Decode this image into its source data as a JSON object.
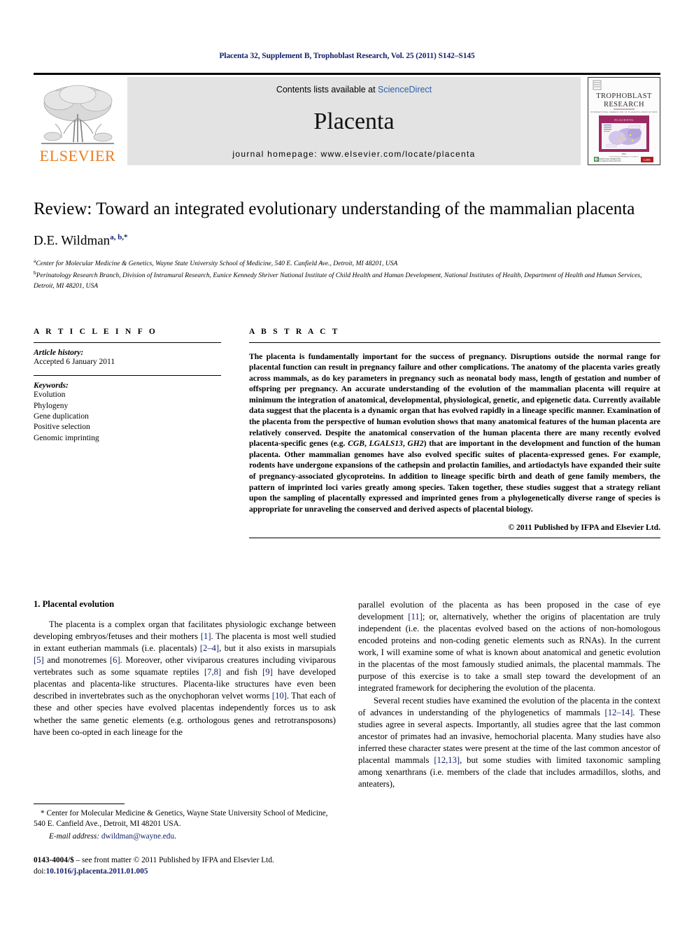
{
  "running_head": "Placenta 32, Supplement B, Trophoblast Research, Vol. 25 (2011) S142–S145",
  "masthead": {
    "publisher_name": "ELSEVIER",
    "contents_prefix": "Contents lists available at ",
    "contents_link": "ScienceDirect",
    "journal_name": "Placenta",
    "homepage": "journal homepage: www.elsevier.com/locate/placenta",
    "cover": {
      "line1": "TROPHOBLAST",
      "line2": "RESEARCH",
      "subtitle": "A JOURNAL OF THE INTERNATIONAL FEDERATION OF PLACENTA ASSOCIATIONS",
      "volume_label": "PLACENTA"
    }
  },
  "article": {
    "title": "Review: Toward an integrated evolutionary understanding of the mammalian placenta",
    "author": "D.E. Wildman",
    "author_marks": "a, b,*",
    "affiliation_a_mark": "a",
    "affiliation_a": "Center for Molecular Medicine & Genetics, Wayne State University School of Medicine, 540 E. Canfield Ave., Detroit, MI 48201, USA",
    "affiliation_b_mark": "b",
    "affiliation_b": "Perinatology Research Branch, Division of Intramural Research, Eunice Kennedy Shriver National Institute of Child Health and Human Development, National Institutes of Health, Department of Health and Human Services, Detroit, MI 48201, USA"
  },
  "article_info": {
    "heading": "A R T I C L E   I N F O",
    "history_label": "Article history:",
    "history_value": "Accepted 6 January 2011",
    "keywords_label": "Keywords:",
    "keywords": [
      "Evolution",
      "Phylogeny",
      "Gene duplication",
      "Positive selection",
      "Genomic imprinting"
    ]
  },
  "abstract": {
    "heading": "A B S T R A C T",
    "part1": "The placenta is fundamentally important for the success of pregnancy. Disruptions outside the normal range for placental function can result in pregnancy failure and other complications. The anatomy of the placenta varies greatly across mammals, as do key parameters in pregnancy such as neonatal body mass, length of gestation and number of offspring per pregnancy. An accurate understanding of the evolution of the mammalian placenta will require at minimum the integration of anatomical, developmental, physiological, genetic, and epigenetic data. Currently available data suggest that the placenta is a dynamic organ that has evolved rapidly in a lineage specific manner. Examination of the placenta from the perspective of human evolution shows that many anatomical features of the human placenta are relatively conserved. Despite the anatomical conservation of the human placenta there are many recently evolved placenta-specific genes (e.g. ",
    "gene1": "CGB",
    "sep1": ", ",
    "gene2": "LGALS13",
    "sep2": ", ",
    "gene3": "GH2",
    "part2": ") that are important in the development and function of the human placenta. Other mammalian genomes have also evolved specific suites of placenta-expressed genes. For example, rodents have undergone expansions of the cathepsin and prolactin families, and artiodactyls have expanded their suite of pregnancy-associated glycoproteins. In addition to lineage specific birth and death of gene family members, the pattern of imprinted loci varies greatly among species. Taken together, these studies suggest that a strategy reliant upon the sampling of placentally expressed and imprinted genes from a phylogenetically diverse range of species is appropriate for unraveling the conserved and derived aspects of placental biology.",
    "copyright": "© 2011 Published by IFPA and Elsevier Ltd."
  },
  "body": {
    "section_heading": "1. Placental evolution",
    "left": {
      "p1_a": "The placenta is a complex organ that facilitates physiologic exchange between developing embryos/fetuses and their mothers ",
      "p1_r1": "[1]",
      "p1_b": ". The placenta is most well studied in extant eutherian mammals (i.e. placentals) ",
      "p1_r2": "[2–4]",
      "p1_c": ", but it also exists in marsupials ",
      "p1_r3": "[5]",
      "p1_d": " and monotremes ",
      "p1_r4": "[6]",
      "p1_e": ". Moreover, other viviparous creatures including viviparous vertebrates such as some squamate reptiles ",
      "p1_r5": "[7,8]",
      "p1_f": " and fish ",
      "p1_r6": "[9]",
      "p1_g": " have developed placentas and placenta-like structures. Placenta-like structures have even been described in invertebrates such as the onychophoran velvet worms ",
      "p1_r7": "[10]",
      "p1_h": ". That each of these and other species have evolved placentas independently forces us to ask whether the same genetic elements (e.g. orthologous genes and retrotransposons) have been co-opted in each lineage for the"
    },
    "right": {
      "p1_a": "parallel evolution of the placenta as has been proposed in the case of eye development ",
      "p1_r1": "[11]",
      "p1_b": "; or, alternatively, whether the origins of placentation are truly independent (i.e. the placentas evolved based on the actions of non-homologous encoded proteins and non-coding genetic elements such as RNAs). In the current work, I will examine some of what is known about anatomical and genetic evolution in the placentas of the most famously studied animals, the placental mammals. The purpose of this exercise is to take a small step toward the development of an integrated framework for deciphering the evolution of the placenta.",
      "p2_a": "Several recent studies have examined the evolution of the placenta in the context of advances in understanding of the phylogenetics of mammals ",
      "p2_r1": "[12–14]",
      "p2_b": ". These studies agree in several aspects. Importantly, all studies agree that the last common ancestor of primates had an invasive, hemochorial placenta. Many studies have also inferred these character states were present at the time of the last common ancestor of placental mammals ",
      "p2_r2": "[12,13]",
      "p2_c": ", but some studies with limited taxonomic sampling among xenarthrans (i.e. members of the clade that includes armadillos, sloths, and anteaters),"
    }
  },
  "footnotes": {
    "corresponding_mark": "*",
    "corresponding_text": " Center for Molecular Medicine & Genetics, Wayne State University School of Medicine, 540 E. Canfield Ave., Detroit, MI 48201 USA.",
    "email_label": "E-mail address:",
    "email_value": "dwildman@wayne.edu",
    "email_trail": "."
  },
  "imprint": {
    "issn_line_a": "0143-4004/$ ",
    "issn_line_b": "– see front matter © 2011 Published by IFPA and Elsevier Ltd.",
    "doi_label": "doi:",
    "doi_value": "10.1016/j.placenta.2011.01.005"
  },
  "colors": {
    "link_blue": "#13216b",
    "sciencedirect_blue": "#2b5fa8",
    "elsevier_orange": "#eb7c1e",
    "band_gray": "#e3e3e3",
    "cover_magenta": "#9c2a62"
  }
}
